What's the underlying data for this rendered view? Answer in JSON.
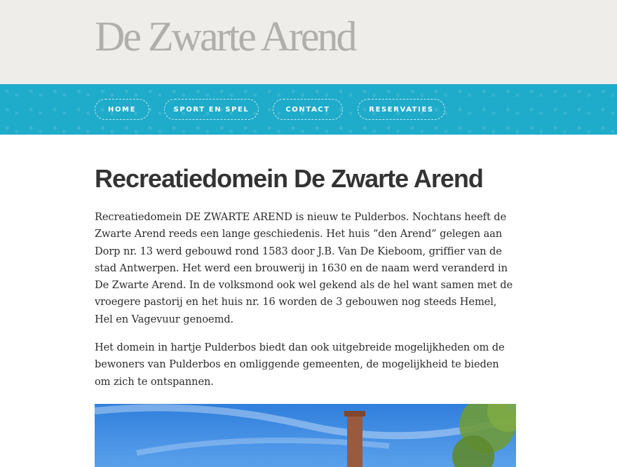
{
  "site": {
    "title": "De Zwarte Arend"
  },
  "nav": {
    "items": [
      {
        "label": "HOME"
      },
      {
        "label": "SPORT EN SPEL"
      },
      {
        "label": "CONTACT"
      },
      {
        "label": "RESERVATIES"
      }
    ]
  },
  "main": {
    "title": "Recreatiedomein De Zwarte Arend",
    "paragraphs": [
      "Recreatiedomein DE ZWARTE AREND is nieuw te Pulderbos. Nochtans heeft de Zwarte Arend reeds een lange geschiedenis. Het huis “den Arend” gelegen aan Dorp nr. 13 werd gebouwd rond 1583 door J.B. Van De Kieboom, griffier van de stad Antwerpen. Het werd een brouwerij in 1630 en de naam werd veranderd in De Zwarte Arend. In de volksmond ook wel gekend als de hel want samen met de vroegere pastorij en het huis nr. 16 worden de 3 gebouwen nog steeds  Hemel, Hel en Vagevuur genoemd.",
      "Het domein in hartje Pulderbos biedt dan ook uitgebreide mogelijkheden om de bewoners van Pulderbos en omliggende gemeenten, de mogelijkheid te bieden om zich te ontspannen."
    ]
  },
  "colors": {
    "header_bg": "#efede9",
    "nav_bg": "#1fabca",
    "title_color": "#b1afab"
  }
}
